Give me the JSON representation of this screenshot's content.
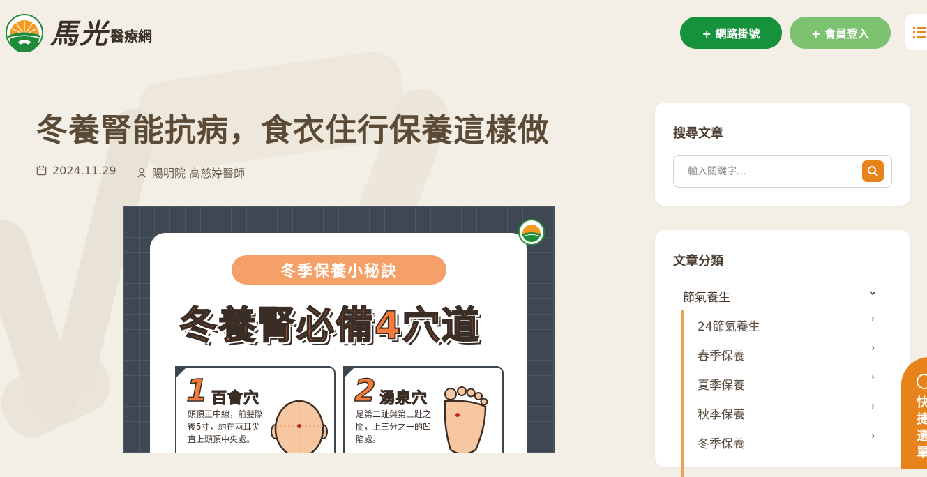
{
  "header": {
    "brand_name": "馬光",
    "brand_sub": "醫療網",
    "register_button": "+ 網路掛號",
    "login_button": "+ 會員登入"
  },
  "article": {
    "title": "冬養腎能抗病，食衣住行保養這樣做",
    "date": "2024.11.29",
    "author": "陽明院 高慈婷醫師"
  },
  "infographic": {
    "pill": "冬季保養小秘訣",
    "headline": "冬養腎必備4穴道",
    "points": [
      {
        "num": "1",
        "name": "百會穴",
        "desc": "頭頂正中線，前髮際後5寸，約在兩耳尖直上頭頂中央處。"
      },
      {
        "num": "2",
        "name": "湧泉穴",
        "desc": "足第二趾與第三趾之間，上三分之一的凹陷處。"
      }
    ]
  },
  "sidebar": {
    "search": {
      "title": "搜尋文章",
      "placeholder": "輸入關鍵字..."
    },
    "categories": {
      "title": "文章分類",
      "parent": "節氣養生",
      "items": [
        {
          "label": "24節氣養生",
          "arrow": "›"
        },
        {
          "label": "春季保養",
          "arrow": "›"
        },
        {
          "label": "夏季保養",
          "arrow": "›"
        },
        {
          "label": "秋季保養",
          "arrow": "›"
        },
        {
          "label": "冬季保養",
          "arrow": "›"
        }
      ]
    }
  },
  "quick_menu": {
    "label": "快捷選單"
  },
  "colors": {
    "background": "#f3efe7",
    "primary_green": "#16923c",
    "light_green": "#7cc270",
    "accent_orange": "#e8821b"
  }
}
